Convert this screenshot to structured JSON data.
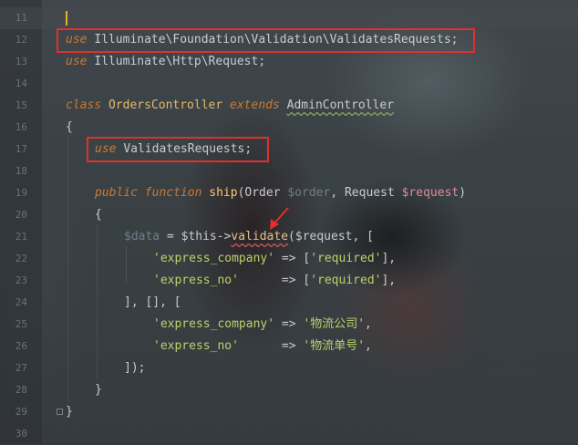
{
  "editor": {
    "line_numbers": [
      "11",
      "12",
      "13",
      "14",
      "15",
      "16",
      "17",
      "18",
      "19",
      "20",
      "21",
      "22",
      "23",
      "24",
      "25",
      "26",
      "27",
      "28",
      "29",
      "30"
    ],
    "kw_use": "use",
    "line12_ns": "Illuminate\\Foundation\\Validation\\ValidatesRequests;",
    "line13_ns": "Illuminate\\Http\\Request;",
    "kw_class": "class",
    "class_name": "OrdersController",
    "kw_extends": "extends",
    "parent_class": "AdminController",
    "brace_open": "{",
    "trait_name": "ValidatesRequests;",
    "kw_public": "public",
    "kw_function": "function",
    "method_name": "ship",
    "method_params_a": "(Order ",
    "param_order": "$order",
    "method_params_b": ", Request ",
    "param_request": "$request",
    "method_params_c": ")",
    "var_data": "$data",
    "assign": " = $this->",
    "call_validate": "validate",
    "call_args": "($request, [",
    "str_express_company": "'express_company'",
    "str_express_no": "'express_no'",
    "arrow_a": " => [",
    "arrow_b": "      => [",
    "str_required": "'required'",
    "close_item": "],",
    "line24": "], [], [",
    "arrow_c": " => ",
    "arrow_d": "      => ",
    "str_cn_company": "'物流公司'",
    "str_cn_no": "'物流单号'",
    "comma": ",",
    "line27": "]);",
    "brace_close": "}"
  },
  "colors": {
    "highlight_box": "#e0302b",
    "caret": "#e6b422"
  }
}
